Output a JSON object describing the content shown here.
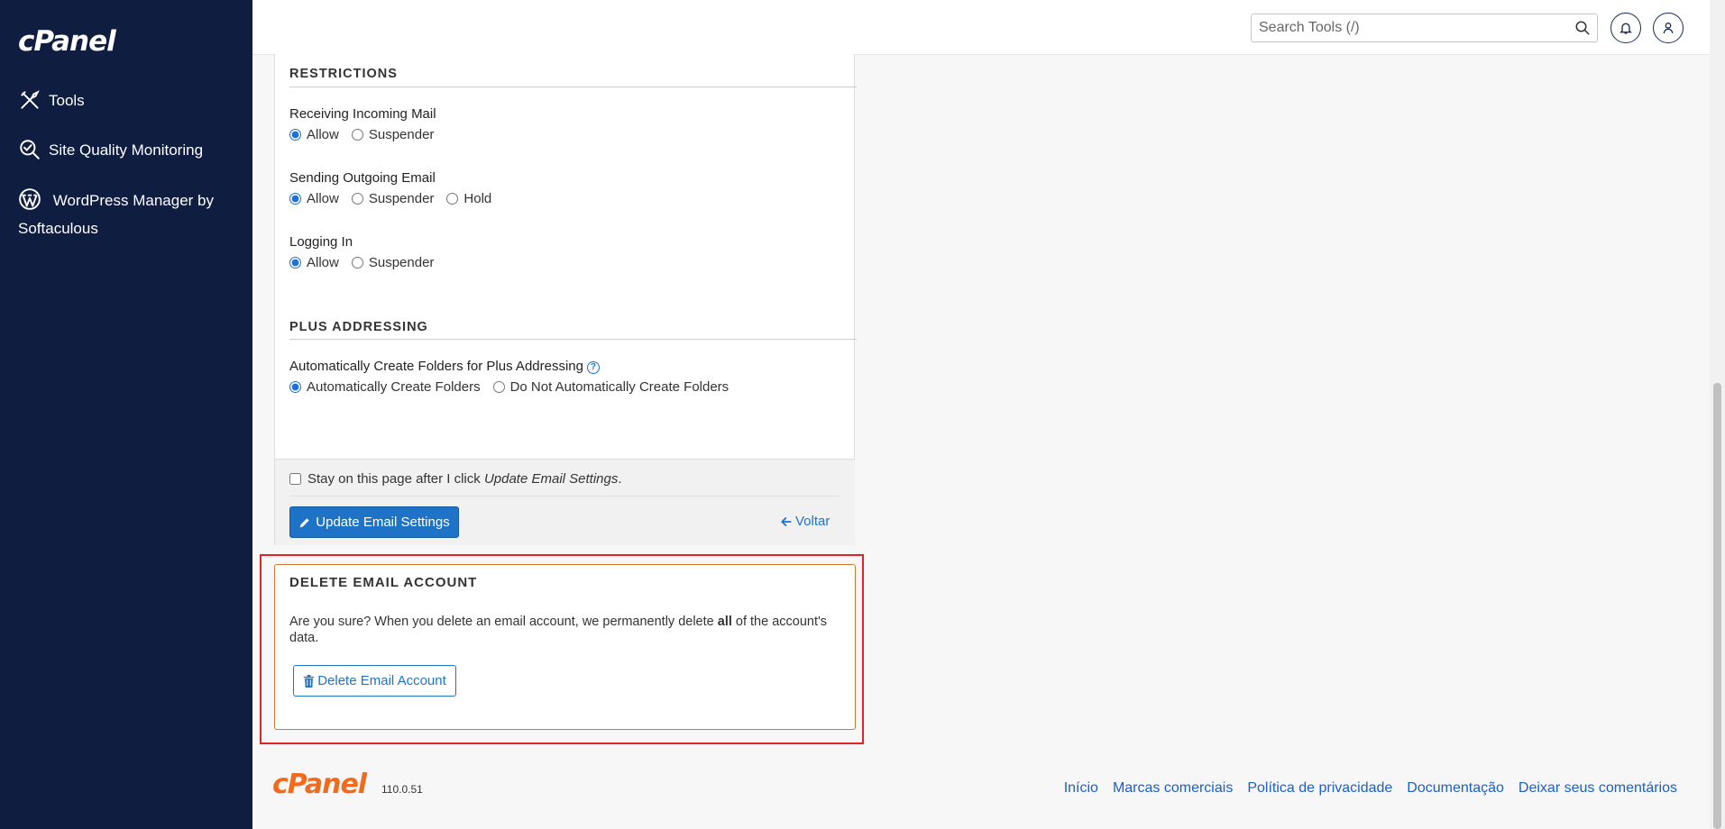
{
  "sidebar": {
    "logo": "cPanel",
    "items": [
      {
        "label": "Tools",
        "icon": "tools-icon"
      },
      {
        "label": "Site Quality Monitoring",
        "icon": "site-quality-icon"
      },
      {
        "label": "WordPress Manager by Softaculous",
        "icon": "wordpress-icon"
      }
    ]
  },
  "header": {
    "search_placeholder": "Search Tools (/)"
  },
  "restrictions": {
    "title": "RESTRICTIONS",
    "receiving": {
      "label": "Receiving Incoming Mail",
      "options": [
        "Allow",
        "Suspender"
      ],
      "selected": "Allow"
    },
    "sending": {
      "label": "Sending Outgoing Email",
      "options": [
        "Allow",
        "Suspender",
        "Hold"
      ],
      "selected": "Allow"
    },
    "login": {
      "label": "Logging In",
      "options": [
        "Allow",
        "Suspender"
      ],
      "selected": "Allow"
    }
  },
  "plus": {
    "title": "PLUS ADDRESSING",
    "label": "Automatically Create Folders for Plus Addressing",
    "help": "?",
    "options": [
      "Automatically Create Folders",
      "Do Not Automatically Create Folders"
    ],
    "selected": "Automatically Create Folders"
  },
  "form_footer": {
    "stay_prefix": "Stay on this page after I click ",
    "stay_emph": "Update Email Settings",
    "stay_suffix": ".",
    "update_label": "Update Email Settings",
    "back_label": "Voltar"
  },
  "delete": {
    "title": "DELETE EMAIL ACCOUNT",
    "text_before": "Are you sure? When you delete an email account, we permanently delete ",
    "text_bold": "all",
    "text_after": " of the account's data.",
    "button_label": "Delete Email Account"
  },
  "footer": {
    "logo": "cPanel",
    "version": "110.0.51",
    "links": [
      "Início",
      "Marcas comerciais",
      "Política de privacidade",
      "Documentação",
      "Deixar seus comentários"
    ]
  },
  "colors": {
    "sidebar_bg": "#0f1d40",
    "primary": "#1f73c6",
    "brand_orange": "#f26b1d",
    "highlight_red": "#e3212b"
  }
}
